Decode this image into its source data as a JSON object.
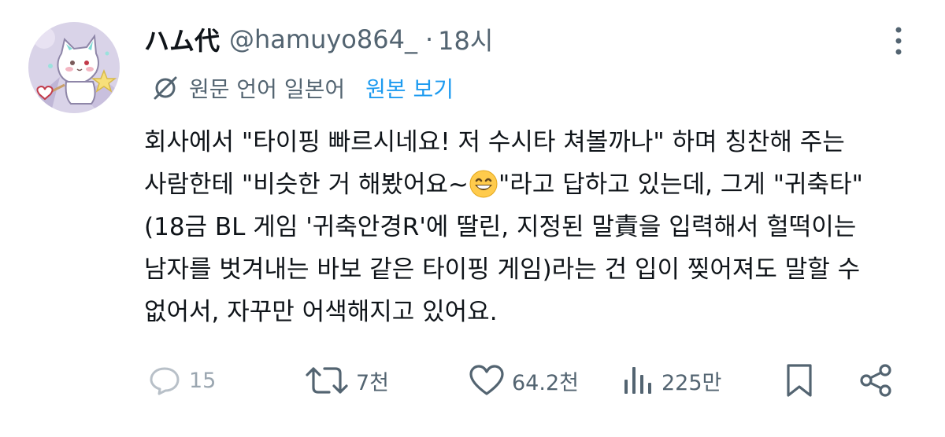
{
  "tweet": {
    "display_name": "ハム代",
    "handle": "@hamuyo864_",
    "separator": "·",
    "time": "18시",
    "translation": {
      "label": "원문 언어 일본어",
      "view_original": "원본 보기"
    },
    "body_lines": [
      "회사에서 \"타이핑 빠르시네요! 저 수시타 쳐볼까나\" 하며 칭찬해 주는",
      "사람한테 \"비슷한 거 해봤어요~",
      "\"라고 답하고 있는데, 그게 \"귀축타\"",
      "(18금 BL 게임 '귀축안경R'에 딸린, 지정된 말責을 입력해서 헐떡이는",
      "남자를 벗겨내는 바보 같은 타이핑 게임)라는 건 입이 찢어져도 말할 수",
      "없어서, 자꾸만 어색해지고 있어요."
    ],
    "icons": {
      "avatar": "cat-avatar-icon",
      "more": "more-vertical-icon",
      "translate": "translate-icon",
      "emoji": "grinning-face-emoji",
      "reply": "reply-icon",
      "retweet": "retweet-icon",
      "like": "heart-icon",
      "views": "views-icon",
      "bookmark": "bookmark-icon",
      "share": "share-icon"
    },
    "stats": {
      "replies": "15",
      "retweets": "7천",
      "likes": "64.2천",
      "views": "225만"
    },
    "colors": {
      "text": "#0f1419",
      "secondary": "#536471",
      "link": "#1d9bf0"
    }
  }
}
